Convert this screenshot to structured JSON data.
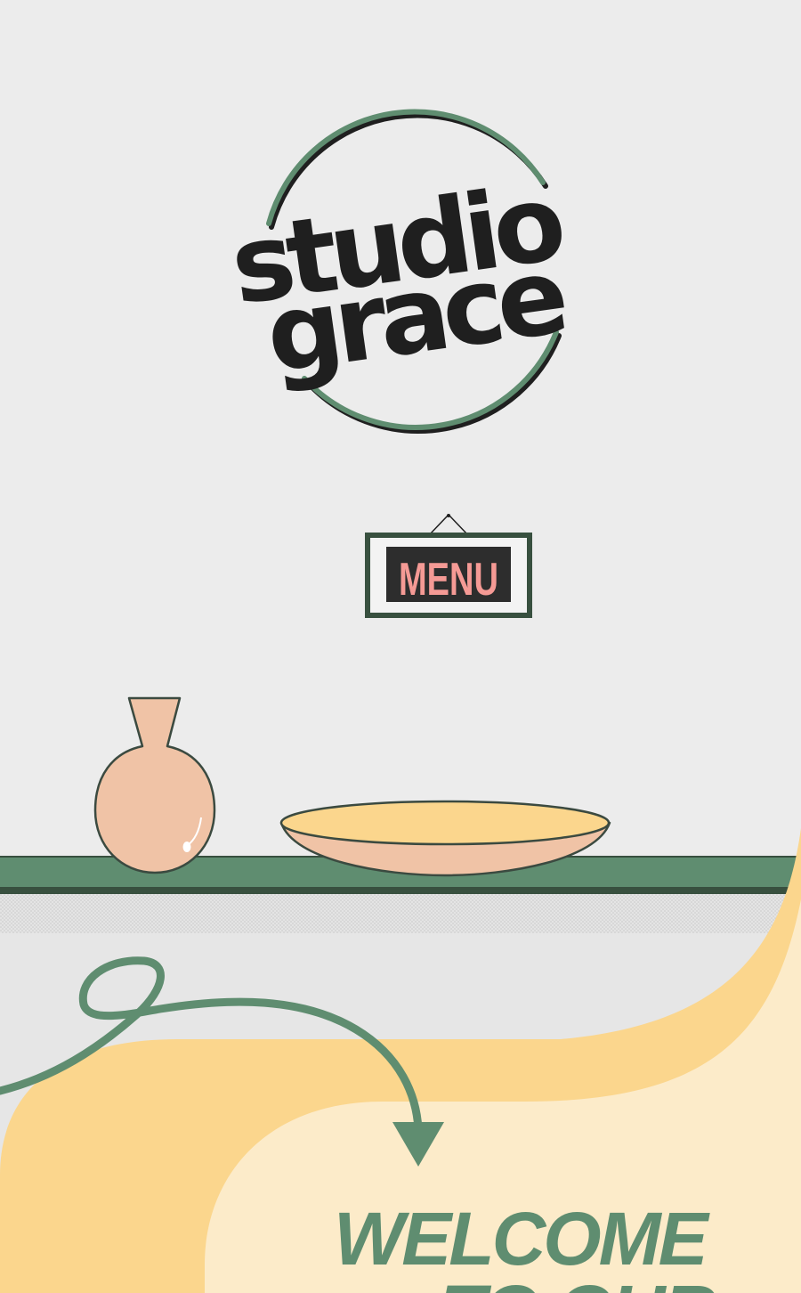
{
  "brand": {
    "logo_line1": "studio",
    "logo_line2": "grace"
  },
  "nav": {
    "menu_label": "MENU"
  },
  "hero": {
    "welcome_line1": "WELCOME",
    "welcome_line2": "TO OUR"
  },
  "colors": {
    "background": "#ececec",
    "accent_green": "#5f8d70",
    "dark_green": "#38503f",
    "mustard": "#fbd68d",
    "cream": "#fcebc9",
    "peach": "#f0c3a6",
    "menu_text": "#f59a95",
    "ink": "#1f1f1f"
  },
  "icons": {
    "vase": "vase-icon",
    "bowl": "bowl-icon",
    "arrow": "squiggle-arrow-icon"
  }
}
